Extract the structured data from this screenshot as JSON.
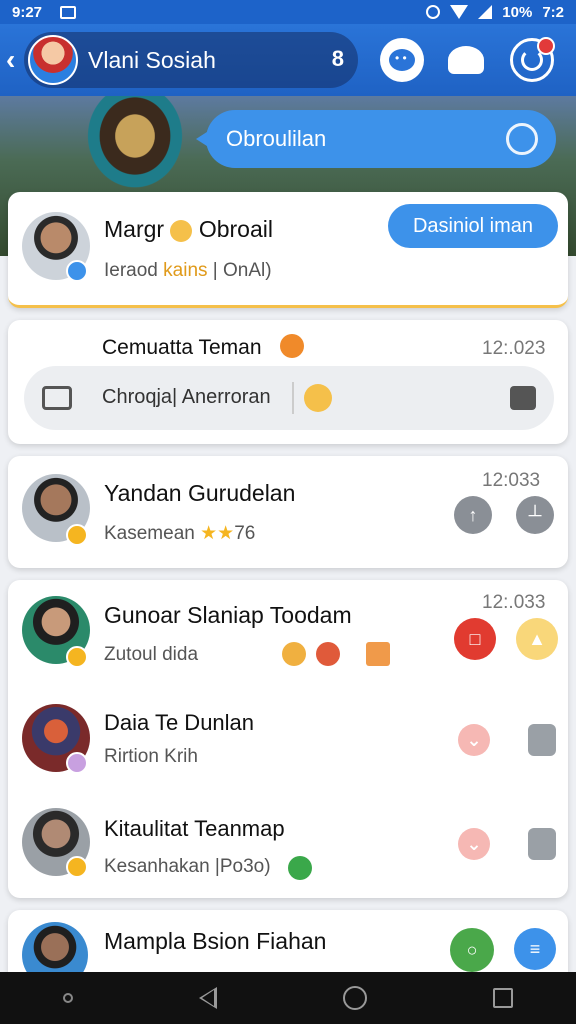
{
  "status_bar": {
    "time": "9:27",
    "battery": "10%",
    "right_time": "7:2"
  },
  "header": {
    "title": "Vlani Sosiah",
    "member_count": "8"
  },
  "hero": {
    "bubble_text": "Obroulilan"
  },
  "pinned": {
    "name_start": "Margr",
    "name_end": "Obroail",
    "subtitle": "Ieraod",
    "subtitle_accent": "kains",
    "subtitle_end": "| OnAl)",
    "button": "Dasiniol iman"
  },
  "compose": {
    "title": "Cemuatta Teman",
    "time": "12:.023",
    "input_text": "Chroqja| Anerroran"
  },
  "chats": [
    {
      "name": "Yandan Gurudelan",
      "subtitle": "Kasemean",
      "extra": "76",
      "time": "12:033"
    },
    {
      "name": "Gunoar Slaniap Toodam",
      "subtitle": "Zutoul dida",
      "time": "12:.033"
    },
    {
      "name": "Daia Te Dunlan",
      "subtitle": "Rirtion Krih"
    },
    {
      "name": "Kitaulitat Teanmap",
      "subtitle": "Kesanhakan |Po3o)"
    },
    {
      "name": "Mampla Bsion Fiahan",
      "subtitle": ""
    }
  ],
  "colors": {
    "accent": "#3d92ea",
    "header": "#1f62c4"
  }
}
